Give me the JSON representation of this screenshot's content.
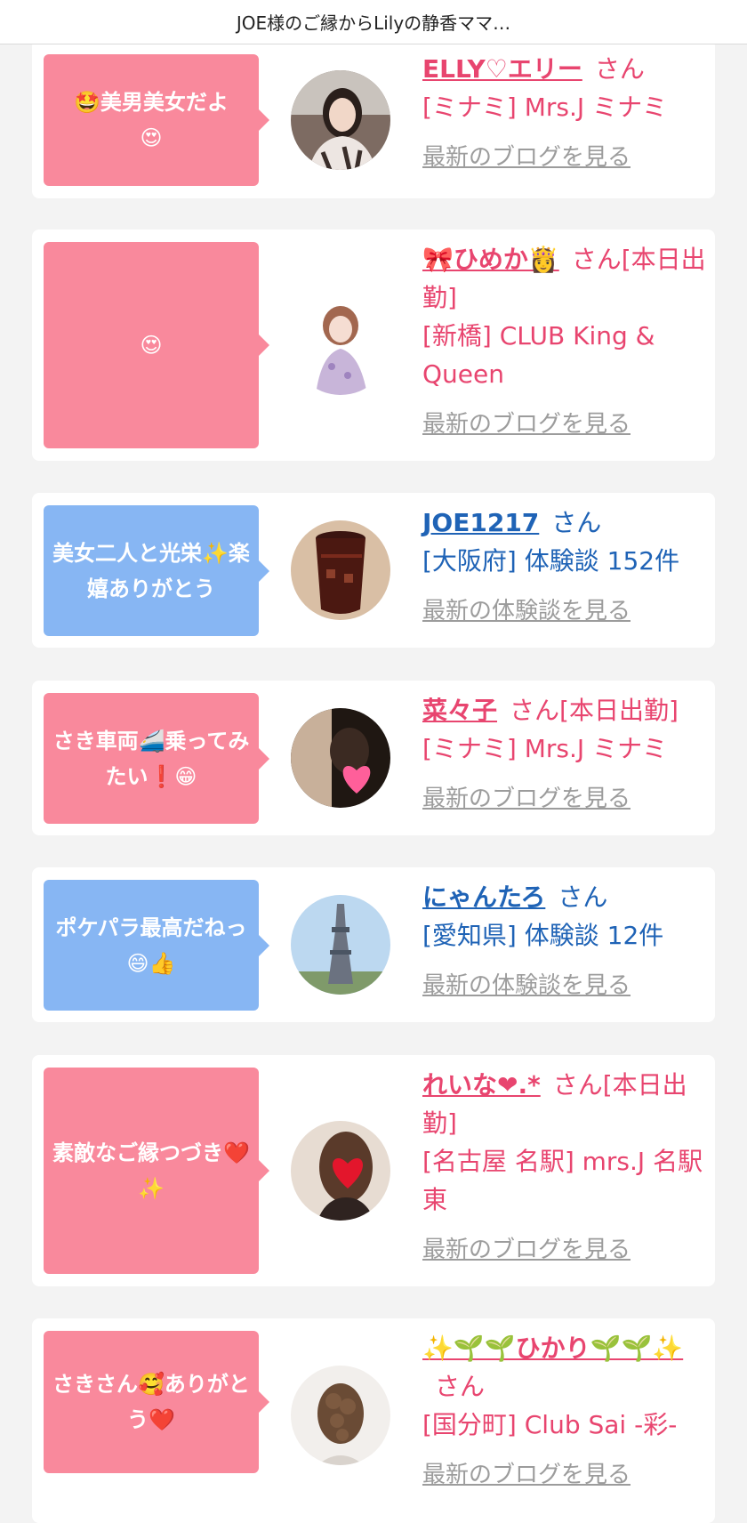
{
  "header": {
    "title": "JOE様のご縁からLilyの静香ママ…"
  },
  "entries": [
    {
      "message": "🤩美男美女だよ😍",
      "name": "ELLY♡エリー",
      "suffix": "さん",
      "detail": "[ミナミ] Mrs.J ミナミ",
      "link": "最新のブログを見る",
      "type": "cast",
      "avatar_icon": "woman-portrait-icon"
    },
    {
      "message": "😍",
      "name": "🎀ひめか👸",
      "suffix": "さん[本日出勤]",
      "detail": "[新橋] CLUB King & Queen",
      "link": "最新のブログを見る",
      "type": "cast",
      "avatar_icon": "woman-dress-icon"
    },
    {
      "message": "美女二人と光栄✨楽嬉ありがとう",
      "name": "JOE1217",
      "suffix": "さん",
      "detail": "[大阪府] 体験談 152件",
      "link": "最新の体験談を見る",
      "type": "user",
      "avatar_icon": "drink-glass-icon"
    },
    {
      "message": "さき車両🚄乗ってみたい❗😁",
      "name": "菜々子",
      "suffix": "さん[本日出勤]",
      "detail": "[ミナミ] Mrs.J ミナミ",
      "link": "最新のブログを見る",
      "type": "cast",
      "avatar_icon": "heart-photo-icon"
    },
    {
      "message": "ポケパラ最高だねっ😄👍",
      "name": "にゃんたろ",
      "suffix": "さん",
      "detail": "[愛知県] 体験談 12件",
      "link": "最新の体験談を見る",
      "type": "user",
      "avatar_icon": "tv-tower-icon"
    },
    {
      "message": "素敵なご縁つづき❤️✨",
      "name": "れいな❤.*",
      "suffix": "さん[本日出勤]",
      "detail": "[名古屋 名駅] mrs.J 名駅東",
      "link": "最新のブログを見る",
      "type": "cast",
      "avatar_icon": "heart-face-icon"
    },
    {
      "message": "さきさん🥰ありがとう❤️",
      "name": "✨🌱🌱ひかり🌱🌱✨",
      "suffix": "さん",
      "detail": "[国分町] Club Sai -彩-",
      "link": "最新のブログを見る",
      "type": "cast",
      "avatar_icon": "hair-back-icon"
    }
  ],
  "colors": {
    "cast_bubble": "#f9899c",
    "user_bubble": "#87b6f3",
    "cast_text": "#e8456f",
    "user_text": "#1f63b6",
    "link": "#9c9c9c"
  }
}
